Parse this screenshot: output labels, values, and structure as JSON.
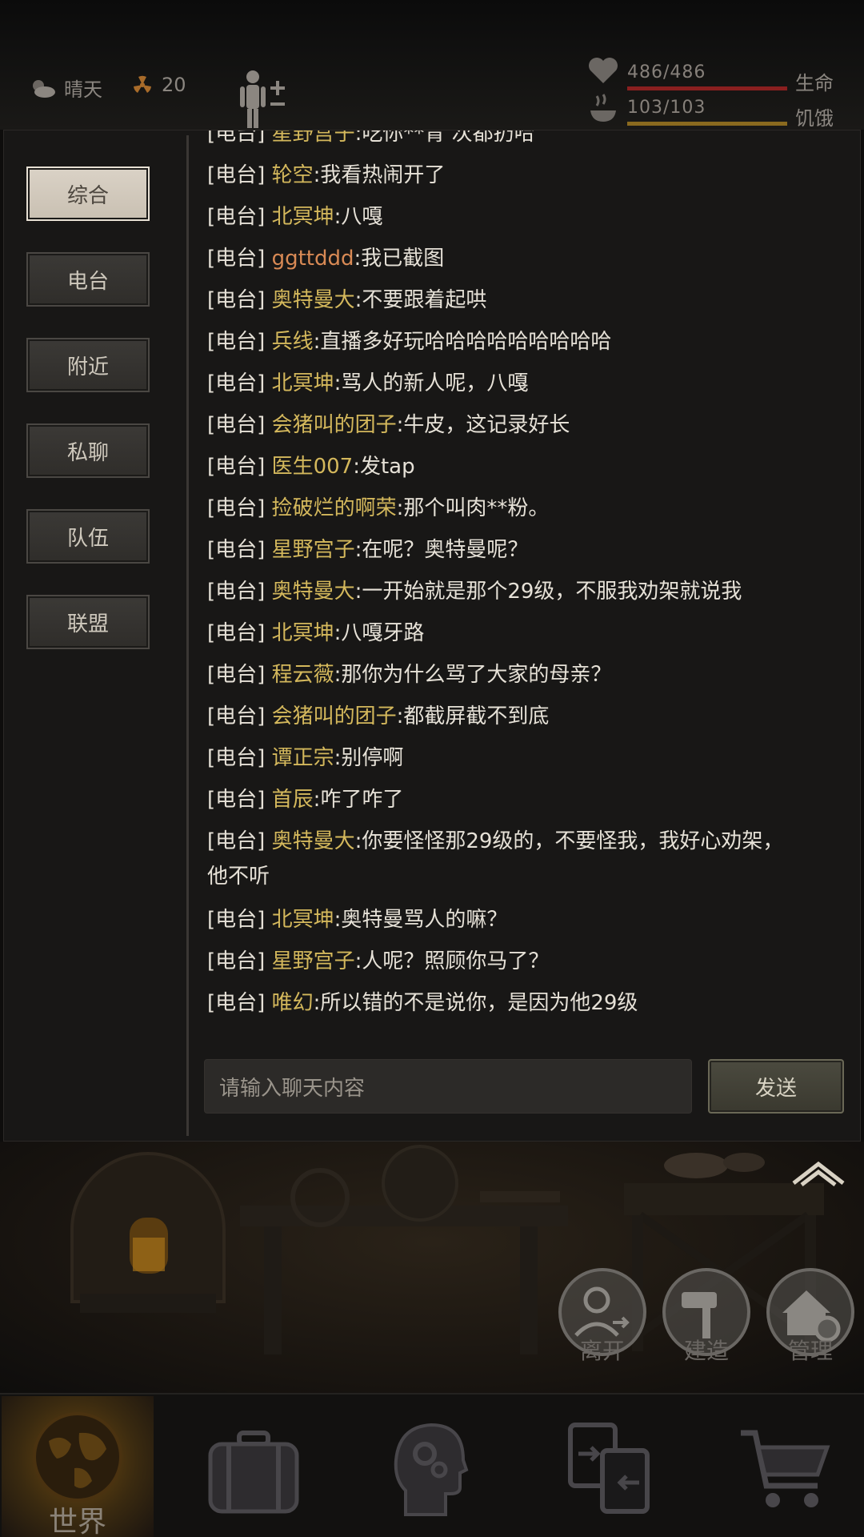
{
  "status": {
    "weather": "晴天",
    "radiation": "20",
    "health": {
      "text": "486/486",
      "label": "生命",
      "fraction": 1.0,
      "color": "#8a1f1f"
    },
    "hunger": {
      "text": "103/103",
      "label": "饥饿",
      "fraction": 1.0,
      "color": "#8a6a1f"
    }
  },
  "sidebar": {
    "tabs": [
      {
        "label": "综合",
        "active": true
      },
      {
        "label": "电台",
        "active": false
      },
      {
        "label": "附近",
        "active": false
      },
      {
        "label": "私聊",
        "active": false
      },
      {
        "label": "队伍",
        "active": false
      },
      {
        "label": "联盟",
        "active": false
      }
    ]
  },
  "messages": [
    {
      "channel": "[电台]",
      "name": "星野宫子",
      "text": ":吃你**青 次都扔哈"
    },
    {
      "channel": "[电台]",
      "name": "轮空",
      "text": ":我看热闹开了"
    },
    {
      "channel": "[电台]",
      "name": "北冥坤",
      "text": ":八嘎"
    },
    {
      "channel": "[电台]",
      "name": "ggttddd",
      "text": ":我已截图"
    },
    {
      "channel": "[电台]",
      "name": "奥特曼大",
      "text": ":不要跟着起哄"
    },
    {
      "channel": "[电台]",
      "name": "兵线",
      "text": ":直播多好玩哈哈哈哈哈哈哈哈哈"
    },
    {
      "channel": "[电台]",
      "name": "北冥坤",
      "text": ":骂人的新人呢，八嘎"
    },
    {
      "channel": "[电台]",
      "name": "会猪叫的团子",
      "text": ":牛皮，这记录好长"
    },
    {
      "channel": "[电台]",
      "name": "医生007",
      "text": ":发tap"
    },
    {
      "channel": "[电台]",
      "name": "捡破烂的啊荣",
      "text": ":那个叫肉**粉。"
    },
    {
      "channel": "[电台]",
      "name": "星野宫子",
      "text": ":在呢？奥特曼呢？"
    },
    {
      "channel": "[电台]",
      "name": "奥特曼大",
      "text": ":一开始就是那个29级，不服我劝架就说我"
    },
    {
      "channel": "[电台]",
      "name": "北冥坤",
      "text": ":八嘎牙路"
    },
    {
      "channel": "[电台]",
      "name": "程云薇",
      "text": ":那你为什么骂了大家的母亲？"
    },
    {
      "channel": "[电台]",
      "name": "会猪叫的团子",
      "text": ":都截屏截不到底"
    },
    {
      "channel": "[电台]",
      "name": "谭正宗",
      "text": ":别停啊"
    },
    {
      "channel": "[电台]",
      "name": "首辰",
      "text": ":咋了咋了"
    },
    {
      "channel": "[电台]",
      "name": "奥特曼大",
      "text": ":你要怪怪那29级的，不要怪我，我好心劝架，"
    },
    {
      "channel": "",
      "name": "",
      "text": "他不听"
    },
    {
      "channel": "[电台]",
      "name": "北冥坤",
      "text": ":奥特曼骂人的嘛？"
    },
    {
      "channel": "[电台]",
      "name": "星野宫子",
      "text": ":人呢？照顾你马了？"
    },
    {
      "channel": "[电台]",
      "name": "唯幻",
      "text": ":所以错的不是说你，是因为他29级"
    }
  ],
  "input": {
    "placeholder": "请输入聊天内容",
    "send_label": "发送"
  },
  "scene": {
    "actions": [
      {
        "label": "离开"
      },
      {
        "label": "建造"
      },
      {
        "label": "管理"
      }
    ]
  },
  "bottom_nav": {
    "items": [
      {
        "label": "世界",
        "icon": "globe-icon",
        "active": true
      },
      {
        "label": "",
        "icon": "suitcase-icon",
        "active": false
      },
      {
        "label": "",
        "icon": "head-gears-icon",
        "active": false
      },
      {
        "label": "",
        "icon": "trade-icon",
        "active": false
      },
      {
        "label": "",
        "icon": "cart-icon",
        "active": false
      }
    ]
  }
}
